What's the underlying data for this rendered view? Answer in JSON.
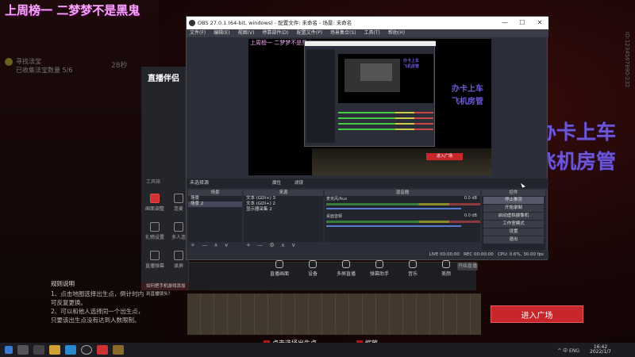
{
  "stream": {
    "banner": "上周榜一 二梦梦不是黑鬼",
    "task_title": "寻找法宝",
    "task_sub": "已收集法宝数量 5/6",
    "task_time": "28秒",
    "right_line1": "办卡上车",
    "right_line2": "飞机房管",
    "side_id": "ID:1234567890-232",
    "rules_title": "规则说明",
    "rules": [
      "1、点击地图选择出生点，倒计时内",
      "可反复更换。",
      "2、可以和他人选择同一个出生点，",
      "只要该出生点没有达到人数限制。"
    ],
    "enter_button": "进入广场",
    "actions": [
      "点击选择出生点",
      "缩放"
    ]
  },
  "assistant": {
    "logo": "直播伴侣",
    "tools_label": "工具箱",
    "items": [
      "画面调整",
      "连麦",
      "礼物设置",
      "多人连",
      "直播弹幕",
      "录屏"
    ],
    "notice": "如何把手机游戏添加到直播镜头？",
    "panel_items": [
      "直播画面",
      "设备",
      "多屏直播",
      "弹幕助手",
      "音乐",
      "美颜"
    ],
    "start_label": "开始直播",
    "side_text": "已设置 1 画面"
  },
  "obs": {
    "title": "OBS 27.0.1 (64-bit, windows) - 配置文件: 未命名 - 场景: 未命名",
    "menu": [
      "文件(F)",
      "编辑(E)",
      "视图(V)",
      "停靠部件(D)",
      "配置文件(P)",
      "场景集合(S)",
      "工具(T)",
      "帮助(H)"
    ],
    "win_controls": [
      "—",
      "☐",
      "✕"
    ],
    "subbar_label": "未选择源",
    "subbar_buttons": [
      "属性",
      "滤镜"
    ],
    "docks": {
      "scenes_title": "场景",
      "sources_title": "来源",
      "mixer_title": "混音器",
      "transitions_title": "转场",
      "controls_title": "控件"
    },
    "scenes": [
      "场景",
      "场景 2"
    ],
    "sources": [
      "文本 (GDI+) 3",
      "文本 (GDI+) 2",
      "显示器采集 2"
    ],
    "mixer": [
      {
        "name": "麦克风/Aux",
        "db": "0.0 dB"
      },
      {
        "name": "桌面音频",
        "db": "0.0 dB"
      }
    ],
    "controls": [
      "停止推流",
      "开始录制",
      "启动虚拟摄像机",
      "工作室模式",
      "设置",
      "退出"
    ],
    "controls_footer": [
      "转场",
      "推流预览"
    ],
    "status": [
      "LIVE 00:00:00",
      "REC 00:00:00",
      "CPU: 0.6%, 30.00 fps"
    ],
    "preview": {
      "banner": "上周榜一 二梦梦不是黑鬼",
      "right_line1": "办卡上车",
      "right_line2": "飞机房管",
      "nested_right": [
        "办卡上车",
        "飞机房管"
      ],
      "enter_button": "进入广场"
    }
  },
  "taskbar": {
    "time": "16:42",
    "date": "2022/1/7",
    "tray": "^ 中 ENG"
  }
}
